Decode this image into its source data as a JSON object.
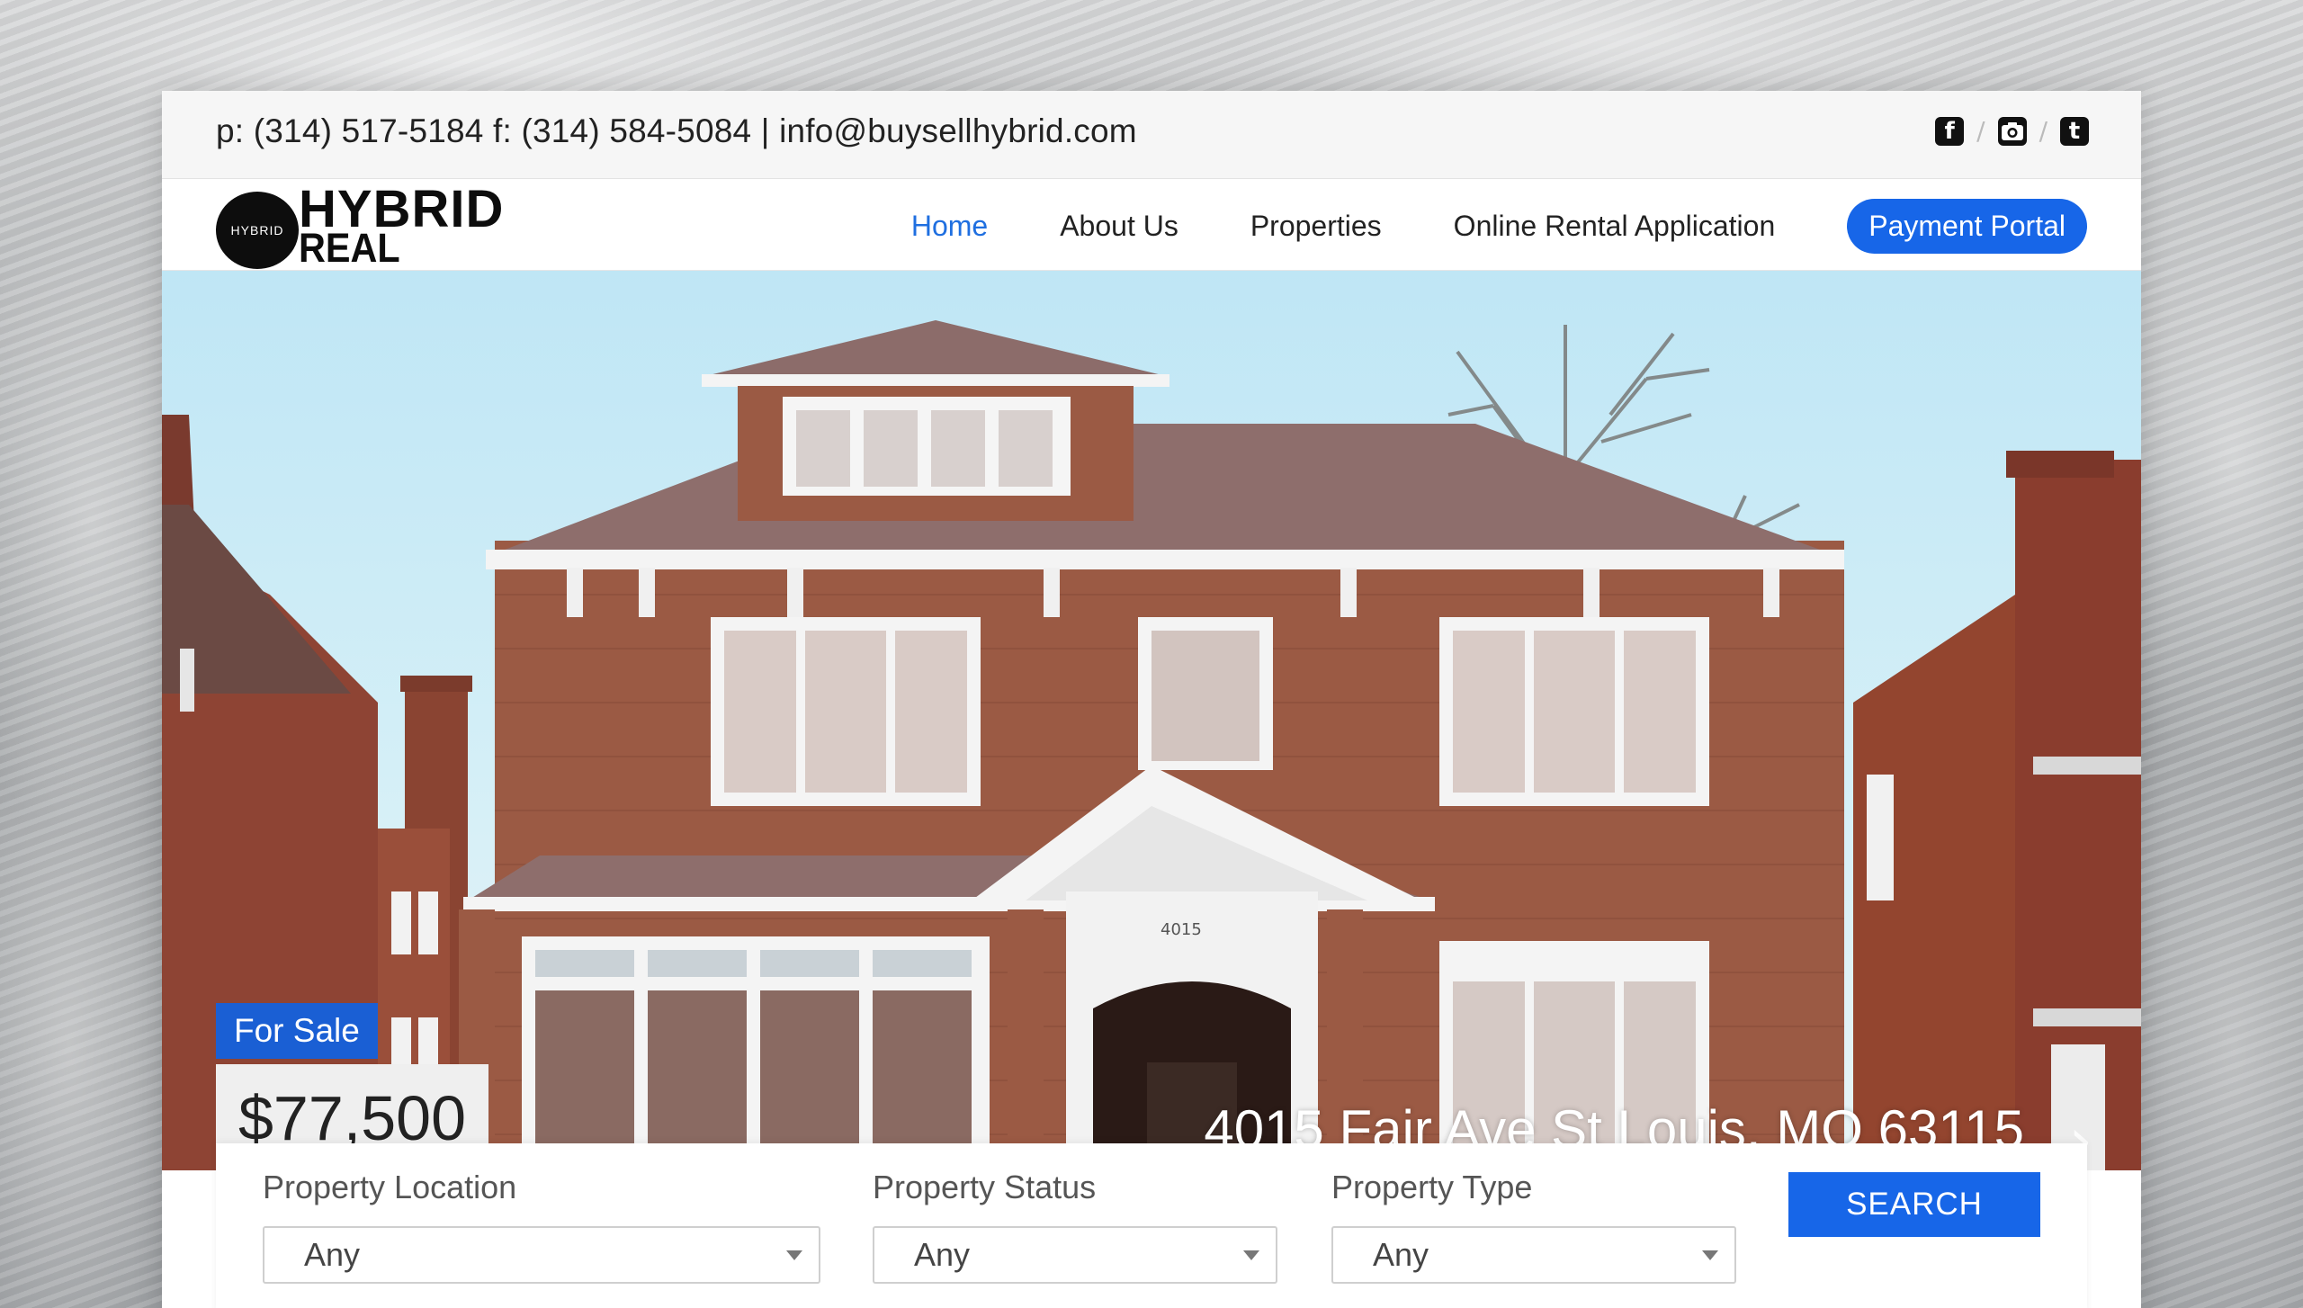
{
  "topbar": {
    "contact": "p: (314) 517-5184 f: (314) 584-5084 | info@buysellhybrid.com",
    "social": [
      {
        "icon": "facebook-icon",
        "glyph": "f"
      },
      {
        "icon": "camera-icon",
        "glyph": "◉"
      },
      {
        "icon": "tumblr-icon",
        "glyph": "t"
      }
    ]
  },
  "logo": {
    "disc_text": "HYBRID",
    "line1": "HYBRID",
    "line2": "REAL ESTATE"
  },
  "nav": {
    "home": "Home",
    "about": "About Us",
    "properties": "Properties",
    "rental": "Online Rental Application",
    "payment": "Payment Portal",
    "active_color": "#1f6fe0",
    "button_color": "#1766e8"
  },
  "hero": {
    "status_badge": "For Sale",
    "price": "$77,500",
    "address": "4015 Fair Ave St Louis, MO 63115",
    "house_number": "4015",
    "next_icon": "chevron-right-icon",
    "next_glyph": "›"
  },
  "search": {
    "location": {
      "label": "Property Location",
      "value": "Any"
    },
    "status": {
      "label": "Property Status",
      "value": "Any"
    },
    "type": {
      "label": "Property Type",
      "value": "Any"
    },
    "button": "SEARCH"
  }
}
